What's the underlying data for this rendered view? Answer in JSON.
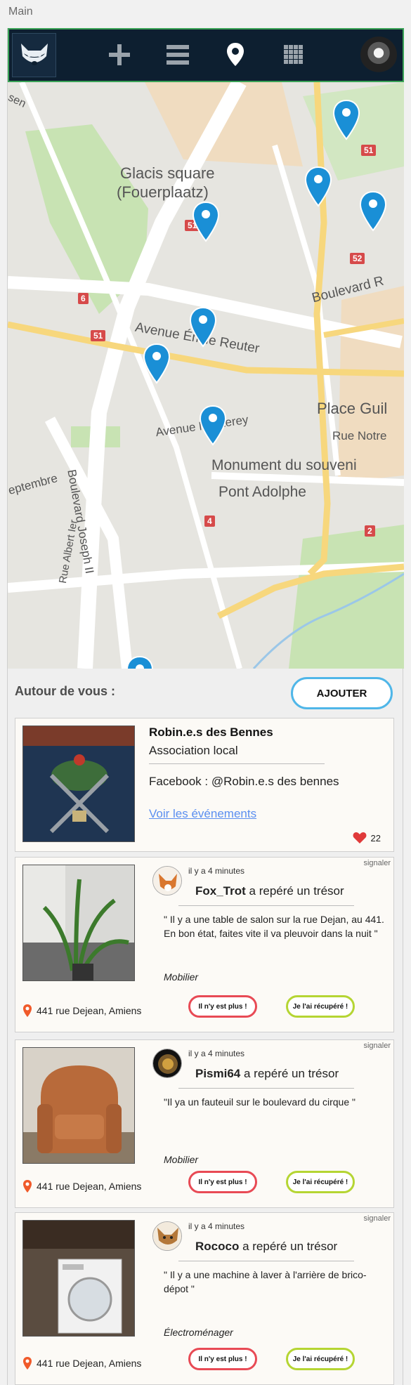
{
  "window": {
    "title": "Main"
  },
  "navbar": {
    "items": [
      {
        "icon": "raccoon-logo-icon"
      },
      {
        "icon": "plus-icon"
      },
      {
        "icon": "list-icon"
      },
      {
        "icon": "map-pin-icon"
      },
      {
        "icon": "grid-icon"
      },
      {
        "icon": "user-avatar"
      }
    ],
    "colors": {
      "background": "#0d1f30",
      "border": "#3aa357"
    }
  },
  "map": {
    "labels": [
      "Glacis square",
      "(Fouerplaatz)",
      "Avenue Émile Reuter",
      "Boulevard R",
      "Boulevard Joseph II",
      "Avenue Monterey",
      "Place Guil",
      "Rue Notre",
      "Monument du souveni",
      "Pont Adolphe",
      "eptembre",
      "Rue Albert Ier",
      "sen"
    ],
    "road_badges": [
      "51",
      "51",
      "52",
      "6",
      "51",
      "4",
      "2"
    ]
  },
  "section": {
    "title": "Autour de vous :",
    "add_label": "AJOUTER"
  },
  "association": {
    "name": "Robin.e.s des Bennes",
    "type": "Association local",
    "facebook": "Facebook : @Robin.e.s des bennes",
    "link": "Voir les événements",
    "likes": "22"
  },
  "posts": [
    {
      "report": "signaler",
      "posted": "il y a 4 minutes",
      "user": "Fox_Trot",
      "action": " a repéré un trésor",
      "quote": "\" Il y a une table de salon sur la rue Dejan, au 441. En bon état, faites vite il va pleuvoir dans la nuit \"",
      "category": "Mobilier",
      "address": "441 rue Dejean, Amiens",
      "gone_label": "Il n'y est plus !",
      "got_label": "Je l'ai récupéré !"
    },
    {
      "report": "signaler",
      "posted": "il y a 4 minutes",
      "user": "Pismi64",
      "action": " a repéré un trésor",
      "quote": "\"Il ya un fauteuil sur le boulevard du cirque \"",
      "category": "Mobilier",
      "address": "441 rue Dejean, Amiens",
      "gone_label": "Il n'y est plus !",
      "got_label": "Je l'ai récupéré !"
    },
    {
      "report": "signaler",
      "posted": "il y a 4 minutes",
      "user": "Rococo",
      "action": " a repéré un trésor",
      "quote": "\" Il y a une machine à laver à l'arrière de brico-dépot \"",
      "category": "Électroménager",
      "address": "441 rue Dejean, Amiens",
      "gone_label": "Il n'y est plus !",
      "got_label": "Je l'ai récupéré !"
    }
  ],
  "colors": {
    "add_button_border": "#4fb6e8",
    "gone_button_border": "#e84a55",
    "got_button_border": "#b5d533",
    "pin": "#1a8fd6",
    "link": "#5b8ff0",
    "heart": "#e03a3a",
    "address_pin": "#f05a2a"
  }
}
